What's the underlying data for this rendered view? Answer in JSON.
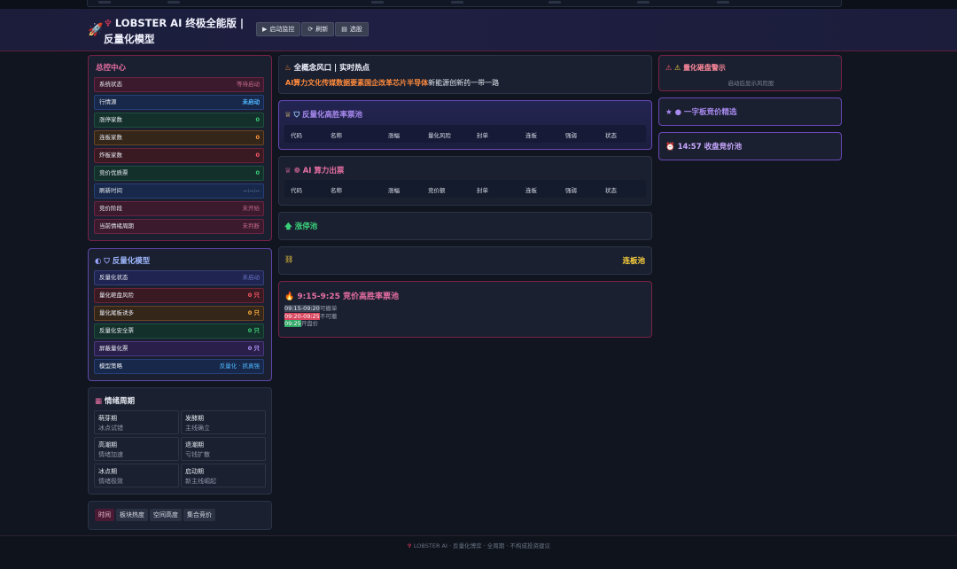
{
  "header": {
    "logo_icon": "lobster-icon",
    "title_line1": "LOBSTER AI 终极全能版 |",
    "title_line2": "反量化模型",
    "buttons": [
      {
        "icon": "▶",
        "label": "启动监控"
      },
      {
        "icon": "⟳",
        "label": "刷新"
      },
      {
        "icon": "▤",
        "label": "选股"
      }
    ]
  },
  "control": {
    "title": "总控中心",
    "rows": [
      {
        "label": "系统状态",
        "value": "等待启动"
      },
      {
        "label": "行情源",
        "value": "未启动"
      },
      {
        "label": "涨停家数",
        "value": "0"
      },
      {
        "label": "连板家数",
        "value": "0"
      },
      {
        "label": "炸板家数",
        "value": "0"
      },
      {
        "label": "竞价优质票",
        "value": "0"
      },
      {
        "label": "刷新时间",
        "value": "--:--:--"
      },
      {
        "label": "竞价阶段",
        "value": "未开始"
      },
      {
        "label": "当前情绪周期",
        "value": "未判断"
      }
    ]
  },
  "antiquant": {
    "title": "反量化模型",
    "rows": [
      {
        "label": "反量化状态",
        "value": "未启动"
      },
      {
        "label": "量化砸盘风险",
        "value": "0 只"
      },
      {
        "label": "量化尾板诱多",
        "value": "0 只"
      },
      {
        "label": "反量化安全票",
        "value": "0 只"
      },
      {
        "label": "屏蔽量化票",
        "value": "0 只"
      },
      {
        "label": "模型策略",
        "value": "反量化 · 抓真强"
      }
    ]
  },
  "emotion": {
    "title": "情绪周期",
    "cells": [
      {
        "name": "萌芽期",
        "desc": "冰点试错"
      },
      {
        "name": "发酵期",
        "desc": "主线确立"
      },
      {
        "name": "高潮期",
        "desc": "情绪加速"
      },
      {
        "name": "退潮期",
        "desc": "亏钱扩散"
      },
      {
        "name": "冰点期",
        "desc": "情绪极致"
      },
      {
        "name": "启动期",
        "desc": "新主线崛起"
      }
    ]
  },
  "bottom_tabs": [
    "时间",
    "板块热度",
    "空间高度",
    "集合竞价"
  ],
  "hot": {
    "title": "全概念风口 | 实时热点",
    "concepts": [
      "AI算力",
      "文化传媒",
      "数据要素",
      "国企改革",
      "芯片半导体",
      "新能源",
      "创新药",
      "一带一路"
    ]
  },
  "pool_high": {
    "title": "反量化高胜率票池",
    "columns": [
      "代码",
      "名称",
      "涨幅",
      "量化风险",
      "封单",
      "连板",
      "强弱",
      "状态"
    ]
  },
  "pool_ai": {
    "title": "AI 算力出票",
    "columns": [
      "代码",
      "名称",
      "涨幅",
      "竞价额",
      "封单",
      "连板",
      "强弱",
      "状态"
    ]
  },
  "limit_up": {
    "title": "涨停池"
  },
  "consec": {
    "title": "连板池"
  },
  "auction": {
    "title": "9:15-9:25 竞价高胜率票池",
    "lines": [
      {
        "time": "09:15-09:20",
        "text": "可撤单"
      },
      {
        "time": "09:20-09:25",
        "text": "不可撤"
      },
      {
        "time": "09:25",
        "text": "开盘价"
      }
    ]
  },
  "warn": {
    "title": "量化砸盘警示",
    "hint": "启动后显示风险股"
  },
  "one_word": {
    "title": "一字板竞价精选"
  },
  "close_pool": {
    "title": "14:57 收盘竞价池"
  },
  "footer": {
    "text": "LOBSTER AI · 反量化博弈 · 全周期 · 不构成投资建议"
  },
  "colors": {
    "accent_pink": "#e86fa3",
    "accent_purple": "#a98af0",
    "green": "#3ad07a",
    "orange": "#ff8a3c",
    "yellow": "#ffd23c"
  }
}
